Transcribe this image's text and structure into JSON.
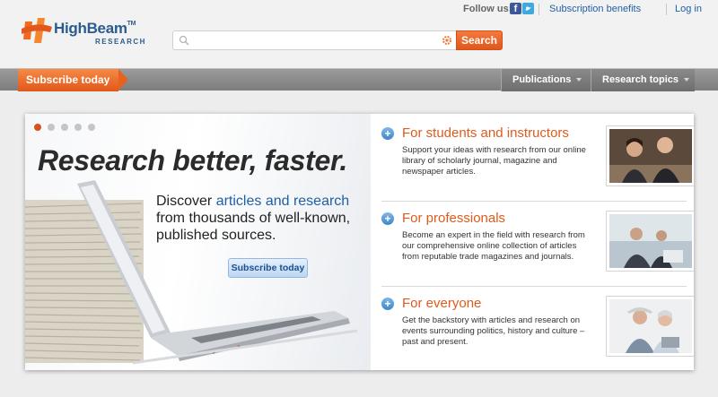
{
  "header": {
    "logo_name": "HighBeam",
    "logo_tm": "TM",
    "logo_sub": "RESEARCH",
    "follow_label": "Follow us:",
    "links": [
      "Subscription benefits",
      "Log in"
    ],
    "search": {
      "placeholder": "",
      "button_label": "Search"
    }
  },
  "nav": {
    "subscribe_label": "Subscribe today",
    "items": [
      "Publications",
      "Research topics"
    ]
  },
  "hero": {
    "slides_total": 5,
    "active_slide": 1,
    "headline": "Research better, faster.",
    "text_before": "Discover ",
    "text_highlight": "articles and research",
    "text_after": " from thousands of well-known, published sources.",
    "button_label": "Subscribe today"
  },
  "audiences": [
    {
      "title": "For students and instructors",
      "description": "Support your ideas with research from our online library of scholarly journal, magazine and newspaper articles."
    },
    {
      "title": "For professionals",
      "description": "Become an expert in the field with research from our comprehensive online collection of articles from reputable trade magazines and journals."
    },
    {
      "title": "For everyone",
      "description": "Get the backstory with articles and research on events surrounding politics, history and culture – past and present."
    }
  ],
  "colors": {
    "accent_orange": "#e2571a",
    "link_blue": "#1f5fa8",
    "nav_gray": "#7d7d7d"
  }
}
